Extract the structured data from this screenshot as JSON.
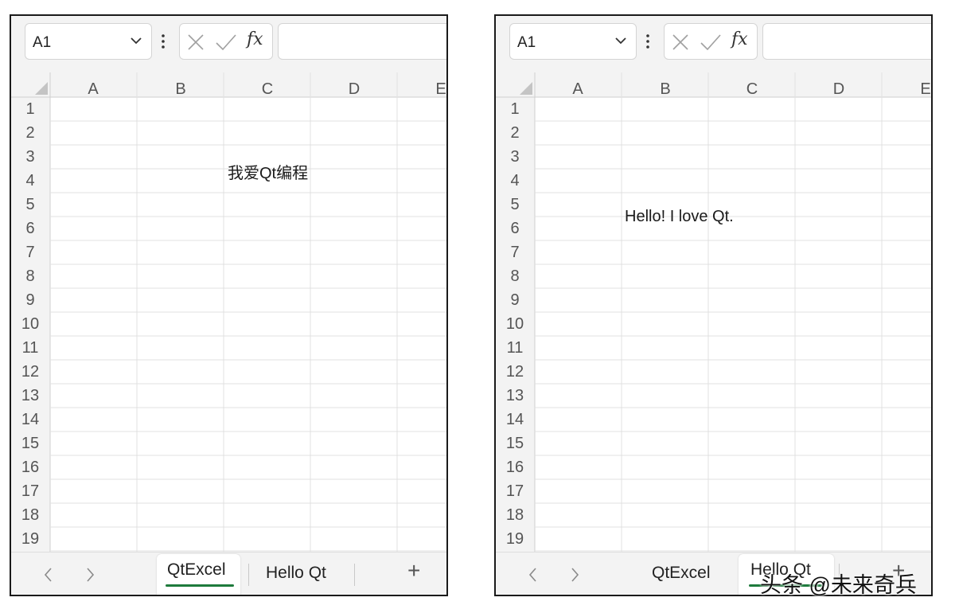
{
  "panes": [
    {
      "name_box": "A1",
      "columns": [
        "A",
        "B",
        "C",
        "D",
        "E"
      ],
      "rows": [
        "1",
        "2",
        "3",
        "4",
        "5",
        "6",
        "7",
        "8",
        "9",
        "10",
        "11",
        "12",
        "13",
        "14",
        "15",
        "16",
        "17",
        "18",
        "19"
      ],
      "cell_text": "我爱Qt编程",
      "tabs": [
        "QtExcel",
        "Hello Qt"
      ],
      "active_tab": "QtExcel",
      "add_sheet": "+"
    },
    {
      "name_box": "A1",
      "columns": [
        "A",
        "B",
        "C",
        "D",
        "E"
      ],
      "rows": [
        "1",
        "2",
        "3",
        "4",
        "5",
        "6",
        "7",
        "8",
        "9",
        "10",
        "11",
        "12",
        "13",
        "14",
        "15",
        "16",
        "17",
        "18",
        "19"
      ],
      "cell_text": "Hello! I love Qt.",
      "tabs": [
        "QtExcel",
        "Hello Qt"
      ],
      "active_tab": "Hello Qt",
      "add_sheet": "+"
    }
  ],
  "fx_label": "fx",
  "watermark": "头条 @未来奇兵",
  "colors": {
    "active_tab_underline": "#1e7a3c",
    "gridline": "#e1e1e1"
  }
}
